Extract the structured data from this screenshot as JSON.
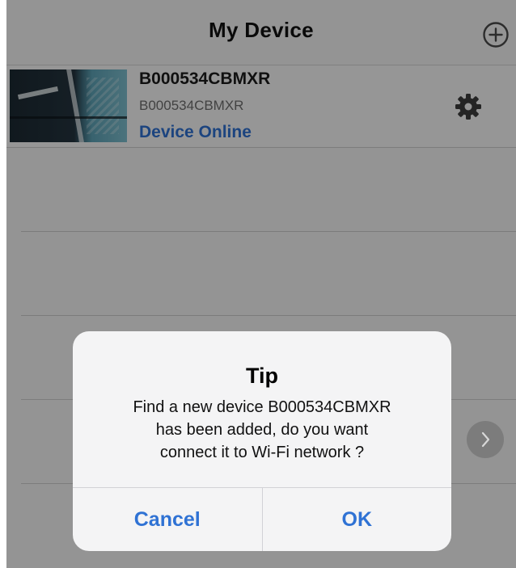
{
  "header": {
    "title": "My Device",
    "add_icon": "plus-circle-icon"
  },
  "device": {
    "name": "B000534CBMXR",
    "id": "B000534CBMXR",
    "status": "Device Online",
    "status_color": "#2f72d4",
    "settings_icon": "gear-icon"
  },
  "dialog": {
    "title": "Tip",
    "message_lines": [
      "Find a new device B000534CBMXR",
      "has been added, do you want",
      "connect it to Wi-Fi network ?"
    ],
    "cancel_label": "Cancel",
    "ok_label": "OK",
    "button_color": "#2f72d4"
  },
  "side_button": {
    "icon": "chevron-right-icon"
  }
}
